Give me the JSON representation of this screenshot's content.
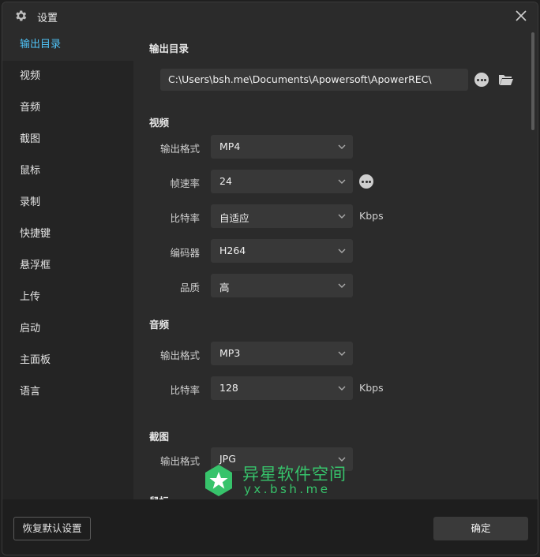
{
  "window": {
    "title": "设置"
  },
  "sidebar": {
    "items": [
      {
        "label": "输出目录",
        "active": true
      },
      {
        "label": "视频"
      },
      {
        "label": "音频"
      },
      {
        "label": "截图"
      },
      {
        "label": "鼠标"
      },
      {
        "label": "录制"
      },
      {
        "label": "快捷键"
      },
      {
        "label": "悬浮框"
      },
      {
        "label": "上传"
      },
      {
        "label": "启动"
      },
      {
        "label": "主面板"
      },
      {
        "label": "语言"
      }
    ]
  },
  "output": {
    "section": "输出目录",
    "path": "C:\\Users\\bsh.me\\Documents\\Apowersoft\\ApowerREC\\"
  },
  "video": {
    "section": "视频",
    "format_label": "输出格式",
    "format_value": "MP4",
    "fps_label": "帧速率",
    "fps_value": "24",
    "bitrate_label": "比特率",
    "bitrate_value": "自适应",
    "bitrate_unit": "Kbps",
    "encoder_label": "编码器",
    "encoder_value": "H264",
    "quality_label": "品质",
    "quality_value": "高"
  },
  "audio": {
    "section": "音频",
    "format_label": "输出格式",
    "format_value": "MP3",
    "bitrate_label": "比特率",
    "bitrate_value": "128",
    "bitrate_unit": "Kbps"
  },
  "screenshot": {
    "section": "截图",
    "format_label": "输出格式",
    "format_value": "JPG"
  },
  "mouse": {
    "section": "鼠标"
  },
  "footer": {
    "reset_label": "恢复默认设置",
    "ok_label": "确定"
  },
  "watermark": {
    "text": "异星软件空间",
    "sub": "yx.bsh.me"
  },
  "colors": {
    "accent": "#4fc3f7",
    "watermark": "#37c36b"
  }
}
